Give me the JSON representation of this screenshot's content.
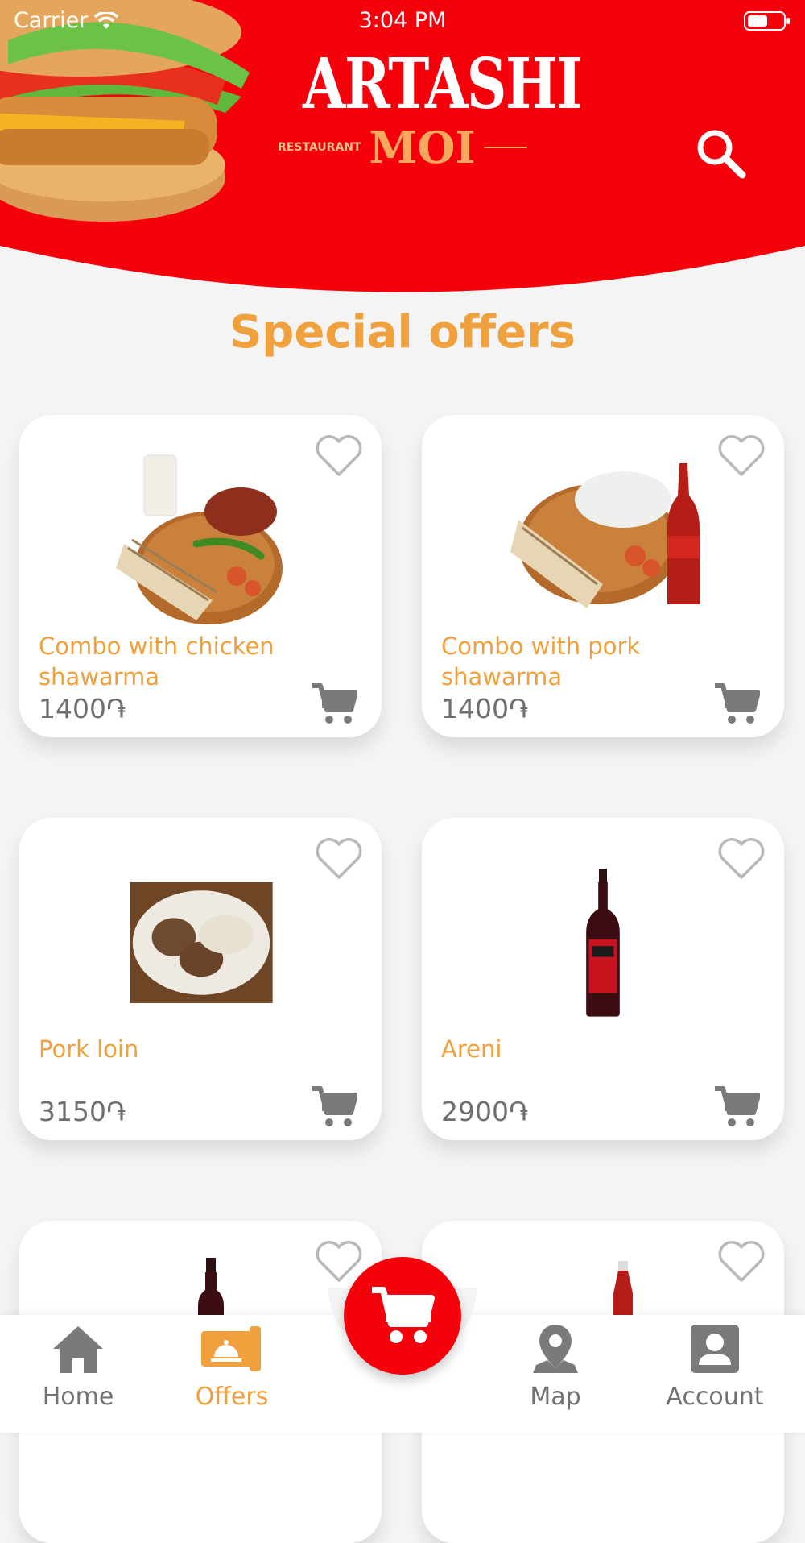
{
  "status_bar": {
    "carrier": "Carrier",
    "time": "3:04 PM"
  },
  "brand": {
    "name": "ARTASHI",
    "restaurant_label": "RESTAURANT",
    "sub": "MOI",
    "primary_color": "#f5000b",
    "accent_color": "#f0a03c"
  },
  "page_title": "Special offers",
  "offers": [
    {
      "name": "Combo with chicken shawarma",
      "price": "1400֏",
      "image": "chicken-shawarma-combo"
    },
    {
      "name": "Combo with pork shawarma",
      "price": "1400֏",
      "image": "pork-shawarma-combo"
    },
    {
      "name": "Pork loin",
      "price": "3150֏",
      "image": "pork-loin-plate"
    },
    {
      "name": "Areni",
      "price": "2900֏",
      "image": "areni-wine-bottle"
    }
  ],
  "tabs": [
    {
      "label": "Home",
      "icon": "home-icon",
      "active": false
    },
    {
      "label": "Offers",
      "icon": "offers-icon",
      "active": true
    },
    {
      "label": "Map",
      "icon": "map-pin-icon",
      "active": false
    },
    {
      "label": "Account",
      "icon": "account-icon",
      "active": false
    }
  ],
  "fab_icon": "cart-icon"
}
